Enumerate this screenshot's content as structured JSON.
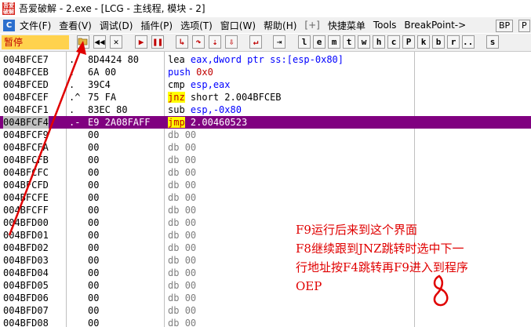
{
  "window": {
    "icon_text": "吾爱破解",
    "title": "吾爱破解 - 2.exe - [LCG - 主线程, 模块 - 2]"
  },
  "menu": {
    "icon": "C",
    "items": [
      "文件(F)",
      "查看(V)",
      "调试(D)",
      "插件(P)",
      "选项(T)",
      "窗口(W)",
      "帮助(H)"
    ],
    "plus": "[+]",
    "items2": [
      "快捷菜单",
      "Tools",
      "BreakPoint->"
    ],
    "tabs": [
      "BP",
      "P"
    ]
  },
  "toolbar": {
    "status": "暂停",
    "buttons": [
      "folder-open",
      "rewind",
      "close",
      "run",
      "pause",
      "step-into",
      "step-over",
      "trace-into",
      "trace-over",
      "execute-till-return",
      "go-to"
    ],
    "letters": [
      "l",
      "e",
      "m",
      "t",
      "w",
      "h",
      "c",
      "P",
      "k",
      "b",
      "r",
      "...",
      "s"
    ]
  },
  "disasm": {
    "rows": [
      {
        "addr": "004BFCE7",
        "mark": ".",
        "hex": "8D4424 80",
        "mn": "lea",
        "cls": "lea",
        "ops": "eax,dword ptr ss:[esp-0x80]",
        "opsClass": "ar-blue"
      },
      {
        "addr": "004BFCEB",
        "mark": ".",
        "hex": "6A 00",
        "mn": "push",
        "cls": "push",
        "ops": "0x0",
        "opsClass": "ar-red"
      },
      {
        "addr": "004BFCED",
        "mark": ".",
        "hex": "39C4",
        "mn": "cmp",
        "cls": "cmp",
        "ops": "esp,eax",
        "opsClass": "ar-blue"
      },
      {
        "addr": "004BFCEF",
        "mark": ".^",
        "hex": "75 FA",
        "mn": "jnz",
        "cls": "jnz",
        "ops": "short 2.004BFCEB",
        "opsClass": ""
      },
      {
        "addr": "004BFCF1",
        "mark": ".",
        "hex": "83EC 80",
        "mn": "sub",
        "cls": "sub",
        "ops": "esp,-0x80",
        "opsClass": "ar-blue"
      },
      {
        "addr": "004BFCF4",
        "mark": ".-",
        "hex": "E9 2A08FAFF",
        "mn": "jmp",
        "cls": "jmp",
        "ops": "2.00460523",
        "opsClass": "",
        "selected": true
      },
      {
        "addr": "004BFCF9",
        "mark": "",
        "hex": "00",
        "mn": "db",
        "cls": "db",
        "ops": "00",
        "opsClass": "db"
      },
      {
        "addr": "004BFCFA",
        "mark": "",
        "hex": "00",
        "mn": "db",
        "cls": "db",
        "ops": "00",
        "opsClass": "db"
      },
      {
        "addr": "004BFCFB",
        "mark": "",
        "hex": "00",
        "mn": "db",
        "cls": "db",
        "ops": "00",
        "opsClass": "db"
      },
      {
        "addr": "004BFCFC",
        "mark": "",
        "hex": "00",
        "mn": "db",
        "cls": "db",
        "ops": "00",
        "opsClass": "db"
      },
      {
        "addr": "004BFCFD",
        "mark": "",
        "hex": "00",
        "mn": "db",
        "cls": "db",
        "ops": "00",
        "opsClass": "db"
      },
      {
        "addr": "004BFCFE",
        "mark": "",
        "hex": "00",
        "mn": "db",
        "cls": "db",
        "ops": "00",
        "opsClass": "db"
      },
      {
        "addr": "004BFCFF",
        "mark": "",
        "hex": "00",
        "mn": "db",
        "cls": "db",
        "ops": "00",
        "opsClass": "db"
      },
      {
        "addr": "004BFD00",
        "mark": "",
        "hex": "00",
        "mn": "db",
        "cls": "db",
        "ops": "00",
        "opsClass": "db"
      },
      {
        "addr": "004BFD01",
        "mark": "",
        "hex": "00",
        "mn": "db",
        "cls": "db",
        "ops": "00",
        "opsClass": "db"
      },
      {
        "addr": "004BFD02",
        "mark": "",
        "hex": "00",
        "mn": "db",
        "cls": "db",
        "ops": "00",
        "opsClass": "db"
      },
      {
        "addr": "004BFD03",
        "mark": "",
        "hex": "00",
        "mn": "db",
        "cls": "db",
        "ops": "00",
        "opsClass": "db"
      },
      {
        "addr": "004BFD04",
        "mark": "",
        "hex": "00",
        "mn": "db",
        "cls": "db",
        "ops": "00",
        "opsClass": "db"
      },
      {
        "addr": "004BFD05",
        "mark": "",
        "hex": "00",
        "mn": "db",
        "cls": "db",
        "ops": "00",
        "opsClass": "db"
      },
      {
        "addr": "004BFD06",
        "mark": "",
        "hex": "00",
        "mn": "db",
        "cls": "db",
        "ops": "00",
        "opsClass": "db"
      },
      {
        "addr": "004BFD07",
        "mark": "",
        "hex": "00",
        "mn": "db",
        "cls": "db",
        "ops": "00",
        "opsClass": "db"
      },
      {
        "addr": "004BFD08",
        "mark": "",
        "hex": "00",
        "mn": "db",
        "cls": "db",
        "ops": "00",
        "opsClass": "db"
      }
    ]
  },
  "annotation": {
    "lines": [
      "F9运行后来到这个界面",
      "F8继续跟到JNZ跳转时选中下一",
      "行地址按F4跳转再F9进入到程序",
      "OEP"
    ],
    "handwritten_digit": "8"
  },
  "colors": {
    "selection": "#800080",
    "status_bg": "#ffd24d",
    "jump_highlight": "#ffff00",
    "annotation": "#e00000"
  }
}
